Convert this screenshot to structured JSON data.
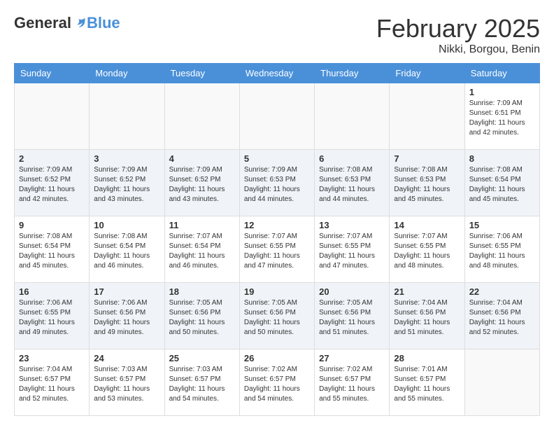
{
  "header": {
    "logo_general": "General",
    "logo_blue": "Blue",
    "month_title": "February 2025",
    "location": "Nikki, Borgou, Benin"
  },
  "days_of_week": [
    "Sunday",
    "Monday",
    "Tuesday",
    "Wednesday",
    "Thursday",
    "Friday",
    "Saturday"
  ],
  "weeks": [
    [
      {
        "day": "",
        "info": ""
      },
      {
        "day": "",
        "info": ""
      },
      {
        "day": "",
        "info": ""
      },
      {
        "day": "",
        "info": ""
      },
      {
        "day": "",
        "info": ""
      },
      {
        "day": "",
        "info": ""
      },
      {
        "day": "1",
        "info": "Sunrise: 7:09 AM\nSunset: 6:51 PM\nDaylight: 11 hours\nand 42 minutes."
      }
    ],
    [
      {
        "day": "2",
        "info": "Sunrise: 7:09 AM\nSunset: 6:52 PM\nDaylight: 11 hours\nand 42 minutes."
      },
      {
        "day": "3",
        "info": "Sunrise: 7:09 AM\nSunset: 6:52 PM\nDaylight: 11 hours\nand 43 minutes."
      },
      {
        "day": "4",
        "info": "Sunrise: 7:09 AM\nSunset: 6:52 PM\nDaylight: 11 hours\nand 43 minutes."
      },
      {
        "day": "5",
        "info": "Sunrise: 7:09 AM\nSunset: 6:53 PM\nDaylight: 11 hours\nand 44 minutes."
      },
      {
        "day": "6",
        "info": "Sunrise: 7:08 AM\nSunset: 6:53 PM\nDaylight: 11 hours\nand 44 minutes."
      },
      {
        "day": "7",
        "info": "Sunrise: 7:08 AM\nSunset: 6:53 PM\nDaylight: 11 hours\nand 45 minutes."
      },
      {
        "day": "8",
        "info": "Sunrise: 7:08 AM\nSunset: 6:54 PM\nDaylight: 11 hours\nand 45 minutes."
      }
    ],
    [
      {
        "day": "9",
        "info": "Sunrise: 7:08 AM\nSunset: 6:54 PM\nDaylight: 11 hours\nand 45 minutes."
      },
      {
        "day": "10",
        "info": "Sunrise: 7:08 AM\nSunset: 6:54 PM\nDaylight: 11 hours\nand 46 minutes."
      },
      {
        "day": "11",
        "info": "Sunrise: 7:07 AM\nSunset: 6:54 PM\nDaylight: 11 hours\nand 46 minutes."
      },
      {
        "day": "12",
        "info": "Sunrise: 7:07 AM\nSunset: 6:55 PM\nDaylight: 11 hours\nand 47 minutes."
      },
      {
        "day": "13",
        "info": "Sunrise: 7:07 AM\nSunset: 6:55 PM\nDaylight: 11 hours\nand 47 minutes."
      },
      {
        "day": "14",
        "info": "Sunrise: 7:07 AM\nSunset: 6:55 PM\nDaylight: 11 hours\nand 48 minutes."
      },
      {
        "day": "15",
        "info": "Sunrise: 7:06 AM\nSunset: 6:55 PM\nDaylight: 11 hours\nand 48 minutes."
      }
    ],
    [
      {
        "day": "16",
        "info": "Sunrise: 7:06 AM\nSunset: 6:55 PM\nDaylight: 11 hours\nand 49 minutes."
      },
      {
        "day": "17",
        "info": "Sunrise: 7:06 AM\nSunset: 6:56 PM\nDaylight: 11 hours\nand 49 minutes."
      },
      {
        "day": "18",
        "info": "Sunrise: 7:05 AM\nSunset: 6:56 PM\nDaylight: 11 hours\nand 50 minutes."
      },
      {
        "day": "19",
        "info": "Sunrise: 7:05 AM\nSunset: 6:56 PM\nDaylight: 11 hours\nand 50 minutes."
      },
      {
        "day": "20",
        "info": "Sunrise: 7:05 AM\nSunset: 6:56 PM\nDaylight: 11 hours\nand 51 minutes."
      },
      {
        "day": "21",
        "info": "Sunrise: 7:04 AM\nSunset: 6:56 PM\nDaylight: 11 hours\nand 51 minutes."
      },
      {
        "day": "22",
        "info": "Sunrise: 7:04 AM\nSunset: 6:56 PM\nDaylight: 11 hours\nand 52 minutes."
      }
    ],
    [
      {
        "day": "23",
        "info": "Sunrise: 7:04 AM\nSunset: 6:57 PM\nDaylight: 11 hours\nand 52 minutes."
      },
      {
        "day": "24",
        "info": "Sunrise: 7:03 AM\nSunset: 6:57 PM\nDaylight: 11 hours\nand 53 minutes."
      },
      {
        "day": "25",
        "info": "Sunrise: 7:03 AM\nSunset: 6:57 PM\nDaylight: 11 hours\nand 54 minutes."
      },
      {
        "day": "26",
        "info": "Sunrise: 7:02 AM\nSunset: 6:57 PM\nDaylight: 11 hours\nand 54 minutes."
      },
      {
        "day": "27",
        "info": "Sunrise: 7:02 AM\nSunset: 6:57 PM\nDaylight: 11 hours\nand 55 minutes."
      },
      {
        "day": "28",
        "info": "Sunrise: 7:01 AM\nSunset: 6:57 PM\nDaylight: 11 hours\nand 55 minutes."
      },
      {
        "day": "",
        "info": ""
      }
    ]
  ]
}
